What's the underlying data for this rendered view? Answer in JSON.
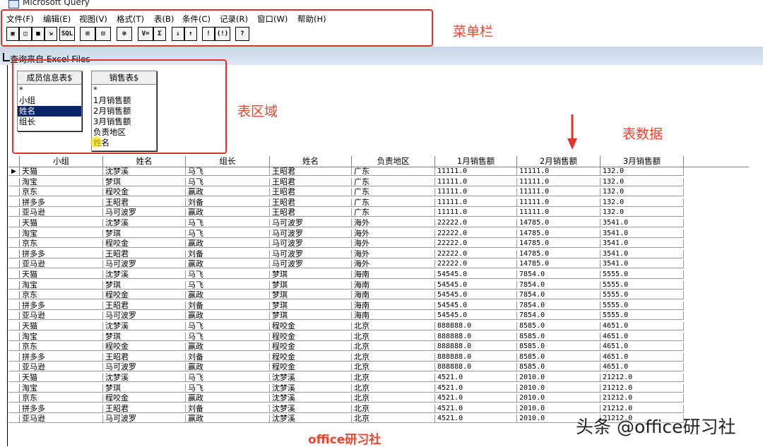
{
  "window": {
    "title": "Microsoft Query"
  },
  "menu": [
    "文件(F)",
    "编辑(E)",
    "视图(V)",
    "格式(T)",
    "表(B)",
    "条件(C)",
    "记录(R)",
    "窗口(W)",
    "帮助(H)"
  ],
  "toolbar": {
    "sql_label": "SQL",
    "sum_label": "Σ",
    "filter_label": "V=",
    "exclaim_label": "!",
    "exclaim_paren_label": "(!)",
    "help_label": "?"
  },
  "annotations": {
    "menu": "菜单栏",
    "tables": "表区域",
    "data": "表数据"
  },
  "query": {
    "title": "查询来自 Excel Files"
  },
  "table1": {
    "name": "成员信息表$",
    "fields": [
      "*",
      "小组",
      "姓名",
      "组长"
    ],
    "selected": 2
  },
  "table2": {
    "name": "销售表$",
    "fields": [
      "*",
      "1月销售额",
      "2月销售额",
      "3月销售额",
      "负责地区",
      "姓名"
    ]
  },
  "grid": {
    "columns": [
      "小组",
      "姓名",
      "组长",
      "姓名",
      "负责地区",
      "1月销售额",
      "2月销售额",
      "3月销售额"
    ],
    "rows": [
      [
        "天猫",
        "沈梦溪",
        "马飞",
        "王昭君",
        "广东",
        "11111.0",
        "11111.0",
        "132.0"
      ],
      [
        "淘宝",
        "梦琪",
        "马飞",
        "王昭君",
        "广东",
        "11111.0",
        "11111.0",
        "132.0"
      ],
      [
        "京东",
        "程咬金",
        "赢政",
        "王昭君",
        "广东",
        "11111.0",
        "11111.0",
        "132.0"
      ],
      [
        "拼多多",
        "王昭君",
        "刘备",
        "王昭君",
        "广东",
        "11111.0",
        "11111.0",
        "132.0"
      ],
      [
        "亚马逊",
        "马可波罗",
        "赢政",
        "王昭君",
        "广东",
        "11111.0",
        "11111.0",
        "132.0"
      ],
      [
        "天猫",
        "沈梦溪",
        "马飞",
        "马可波罗",
        "海外",
        "22222.0",
        "14785.0",
        "3541.0"
      ],
      [
        "淘宝",
        "梦琪",
        "马飞",
        "马可波罗",
        "海外",
        "22222.0",
        "14785.0",
        "3541.0"
      ],
      [
        "京东",
        "程咬金",
        "赢政",
        "马可波罗",
        "海外",
        "22222.0",
        "14785.0",
        "3541.0"
      ],
      [
        "拼多多",
        "王昭君",
        "刘备",
        "马可波罗",
        "海外",
        "22222.0",
        "14785.0",
        "3541.0"
      ],
      [
        "亚马逊",
        "马可波罗",
        "赢政",
        "马可波罗",
        "海外",
        "22222.0",
        "14785.0",
        "3541.0"
      ],
      [
        "天猫",
        "沈梦溪",
        "马飞",
        "梦琪",
        "海南",
        "54545.0",
        "7854.0",
        "5555.0"
      ],
      [
        "淘宝",
        "梦琪",
        "马飞",
        "梦琪",
        "海南",
        "54545.0",
        "7854.0",
        "5555.0"
      ],
      [
        "京东",
        "程咬金",
        "赢政",
        "梦琪",
        "海南",
        "54545.0",
        "7854.0",
        "5555.0"
      ],
      [
        "拼多多",
        "王昭君",
        "刘备",
        "梦琪",
        "海南",
        "54545.0",
        "7854.0",
        "5555.0"
      ],
      [
        "亚马逊",
        "马可波罗",
        "赢政",
        "梦琪",
        "海南",
        "54545.0",
        "7854.0",
        "5555.0"
      ],
      [
        "天猫",
        "沈梦溪",
        "马飞",
        "程咬金",
        "北京",
        "888888.0",
        "8585.0",
        "4651.0"
      ],
      [
        "淘宝",
        "梦琪",
        "马飞",
        "程咬金",
        "北京",
        "888888.0",
        "8585.0",
        "4651.0"
      ],
      [
        "京东",
        "程咬金",
        "赢政",
        "程咬金",
        "北京",
        "888888.0",
        "8585.0",
        "4651.0"
      ],
      [
        "拼多多",
        "王昭君",
        "刘备",
        "程咬金",
        "北京",
        "888888.0",
        "8585.0",
        "4651.0"
      ],
      [
        "亚马逊",
        "马可波罗",
        "赢政",
        "程咬金",
        "北京",
        "888888.0",
        "8585.0",
        "4651.0"
      ],
      [
        "天猫",
        "沈梦溪",
        "马飞",
        "沈梦溪",
        "北京",
        "4521.0",
        "2010.0",
        "21212.0"
      ],
      [
        "淘宝",
        "梦琪",
        "马飞",
        "沈梦溪",
        "北京",
        "4521.0",
        "2010.0",
        "21212.0"
      ],
      [
        "京东",
        "程咬金",
        "赢政",
        "沈梦溪",
        "北京",
        "4521.0",
        "2010.0",
        "21212.0"
      ],
      [
        "拼多多",
        "王昭君",
        "刘备",
        "沈梦溪",
        "北京",
        "4521.0",
        "2010.0",
        "21212.0"
      ],
      [
        "亚马逊",
        "马可波罗",
        "赢政",
        "沈梦溪",
        "北京",
        "4521.0",
        "2010.0",
        "21212.0"
      ]
    ]
  },
  "watermark": "office研习社",
  "credit": "头条 @office研习社"
}
